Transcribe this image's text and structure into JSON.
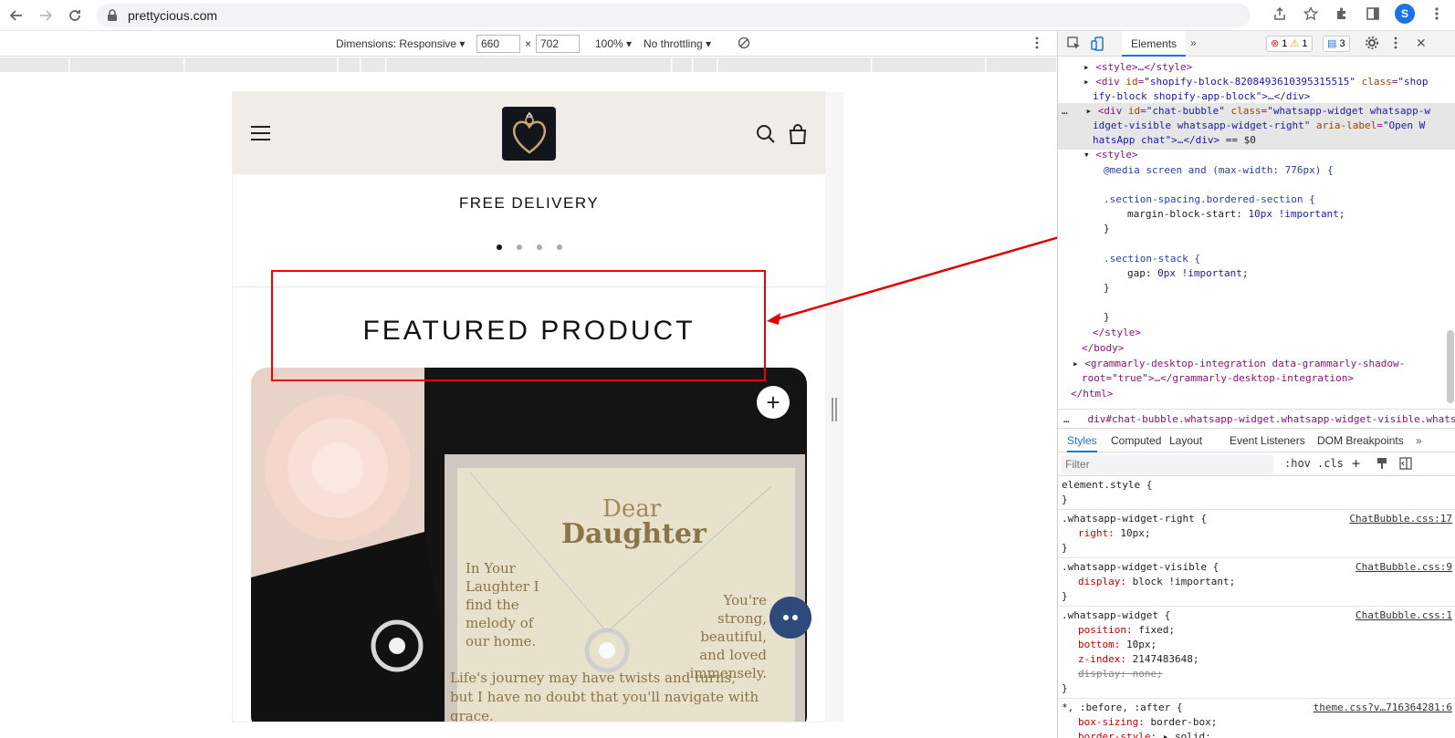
{
  "browser": {
    "url": "prettycious.com",
    "avatar_initial": "S"
  },
  "device_toolbar": {
    "dimensions_label": "Dimensions: Responsive",
    "width": "660",
    "times": "×",
    "height": "702",
    "zoom": "100%",
    "throttling": "No throttling"
  },
  "site": {
    "announcement": "FREE DELIVERY",
    "featured_title": "FEATURED PRODUCT",
    "add_symbol": "+",
    "product_text": {
      "dear": "Dear",
      "daughter": "Daughter",
      "left_poem": "In Your Laughter I find the melody of our home.",
      "right_poem": "You're strong, beautiful, and loved immensely.",
      "bottom_poem": "Life's journey may have twists and turns, but I have no doubt that you'll navigate with grace."
    }
  },
  "devtools": {
    "tab_elements": "Elements",
    "errors": "1",
    "warnings": "1",
    "messages": "3",
    "dom": {
      "l1": "<style>…</style>",
      "l2a": "<div",
      "l2_id_attr": "id",
      "l2_id_val": "\"shopify-block-8208493610395315515\"",
      "l2_class_attr": "class",
      "l2_class_val_1": "\"shop",
      "l3": "ify-block shopify-app-block\">…</div>",
      "l4_id_val": "\"chat-bubble\"",
      "l4_class_val_1": "\"whatsapp-widget whatsapp-w",
      "l5": "idget-visible whatsapp-widget-right\"",
      "l5_aria_attr": "aria-label",
      "l5_aria_val": "\"Open W",
      "l6": "hatsApp chat\">…</div>",
      "l6_eq": "== $0",
      "style_open": "<style>",
      "media": "@media screen and (max-width: 776px) {",
      "sel1": ".section-spacing.bordered-section {",
      "decl1_prop": "margin-block-start:",
      "decl1_val": "10px !important;",
      "close1": "}",
      "sel2": ".section-stack {",
      "decl2_prop": "gap:",
      "decl2_val": "0px !important;",
      "close2": "}",
      "close3": "}",
      "style_close": "</style>",
      "body_close": "</body>",
      "grammarly1": "<grammarly-desktop-integration data-grammarly-shadow-",
      "grammarly2": "root=\"true\">…</grammarly-desktop-integration>",
      "html_close": "</html>"
    },
    "breadcrumb": "div#chat-bubble.whatsapp-widget.whatsapp-widget-visible.whatsap",
    "styles_tabs": [
      "Styles",
      "Computed",
      "Layout",
      "Event Listeners",
      "DOM Breakpoints"
    ],
    "filter_placeholder": "Filter",
    "hov": ":hov",
    "cls": ".cls",
    "rules": [
      {
        "selector": "element.style {",
        "source": "",
        "decls": []
      },
      {
        "selector": ".whatsapp-widget-right {",
        "source": "ChatBubble.css:17",
        "decls": [
          {
            "p": "right:",
            "v": "10px;"
          }
        ]
      },
      {
        "selector": ".whatsapp-widget-visible {",
        "source": "ChatBubble.css:9",
        "decls": [
          {
            "p": "display:",
            "v": "block !important;"
          }
        ]
      },
      {
        "selector": ".whatsapp-widget {",
        "source": "ChatBubble.css:1",
        "decls": [
          {
            "p": "position:",
            "v": "fixed;"
          },
          {
            "p": "bottom:",
            "v": "10px;"
          },
          {
            "p": "z-index:",
            "v": "2147483648;"
          },
          {
            "p": "display:",
            "v": "none;",
            "struck": true
          }
        ]
      },
      {
        "selector": "*, :before, :after {",
        "source": "theme.css?v…716364281:6",
        "decls": [
          {
            "p": "box-sizing:",
            "v": "border-box;"
          },
          {
            "p": "border-style:",
            "v": "▸ solid;"
          }
        ]
      }
    ]
  },
  "colors": {
    "annotation": "#e00000",
    "header_bg": "#f0ece7",
    "accent": "#1a73e8"
  }
}
